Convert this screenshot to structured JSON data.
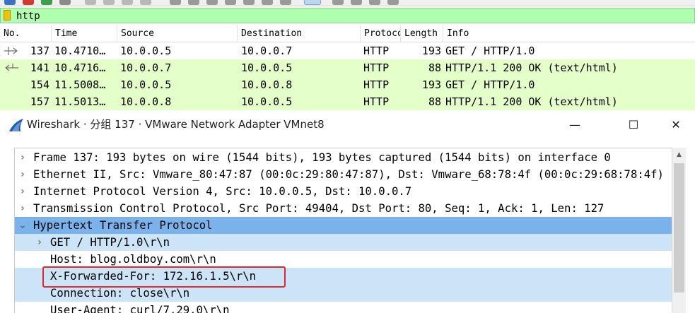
{
  "filter": {
    "value": "http"
  },
  "packet_list": {
    "columns": [
      "No.",
      "Time",
      "Source",
      "Destination",
      "Protocol",
      "Length",
      "Info"
    ],
    "rows": [
      {
        "no": "137",
        "time": "10.4710…",
        "source": "10.0.0.5",
        "destination": "10.0.0.7",
        "protocol": "HTTP",
        "length": "193",
        "info": "GET / HTTP/1.0",
        "bg": "#ffffff",
        "rel": "request"
      },
      {
        "no": "141",
        "time": "10.4716…",
        "source": "10.0.0.7",
        "destination": "10.0.0.5",
        "protocol": "HTTP",
        "length": "88",
        "info": "HTTP/1.1 200 OK  (text/html)",
        "bg": "#e4ffc7",
        "rel": "response"
      },
      {
        "no": "154",
        "time": "11.5008…",
        "source": "10.0.0.5",
        "destination": "10.0.0.8",
        "protocol": "HTTP",
        "length": "193",
        "info": "GET / HTTP/1.0",
        "bg": "#e4ffc7",
        "rel": ""
      },
      {
        "no": "157",
        "time": "11.5013…",
        "source": "10.0.0.8",
        "destination": "10.0.0.5",
        "protocol": "HTTP",
        "length": "88",
        "info": "HTTP/1.1 200 OK  (text/html)",
        "bg": "#e4ffc7",
        "rel": ""
      }
    ]
  },
  "detail_window": {
    "title": "Wireshark · 分组 137 · VMware Network Adapter VMnet8",
    "minimize": "—",
    "maximize": "☐",
    "close": "✕",
    "tree": [
      {
        "text": "Frame 137: 193 bytes on wire (1544 bits), 193 bytes captured (1544 bits) on interface 0",
        "arrow": "›",
        "level": 0,
        "style": ""
      },
      {
        "text": "Ethernet II, Src: Vmware_80:47:87 (00:0c:29:80:47:87), Dst: Vmware_68:78:4f (00:0c:29:68:78:4f)",
        "arrow": "›",
        "level": 0,
        "style": ""
      },
      {
        "text": "Internet Protocol Version 4, Src: 10.0.0.5, Dst: 10.0.0.7",
        "arrow": "›",
        "level": 0,
        "style": ""
      },
      {
        "text": "Transmission Control Protocol, Src Port: 49404, Dst Port: 80, Seq: 1, Ack: 1, Len: 127",
        "arrow": "›",
        "level": 0,
        "style": ""
      },
      {
        "text": "Hypertext Transfer Protocol",
        "arrow": "⌄",
        "level": 0,
        "style": "sel"
      },
      {
        "text": "GET / HTTP/1.0\\r\\n",
        "arrow": "›",
        "level": 1,
        "style": "child"
      },
      {
        "text": "Host: blog.oldboy.com\\r\\n",
        "arrow": "",
        "level": 1,
        "style": ""
      },
      {
        "text": "X-Forwarded-For: 172.16.1.5\\r\\n",
        "arrow": "",
        "level": 1,
        "style": "child"
      },
      {
        "text": "Connection: close\\r\\n",
        "arrow": "",
        "level": 1,
        "style": "child"
      },
      {
        "text": "User-Agent: curl/7.29.0\\r\\n",
        "arrow": "",
        "level": 1,
        "style": ""
      }
    ]
  },
  "colors": {
    "filter_ok": "#afffaf",
    "http_row": "#e4ffc7",
    "tree_selected": "#7ab2ec",
    "tree_child": "#cce4f7",
    "annotation_box": "#e3262b"
  }
}
